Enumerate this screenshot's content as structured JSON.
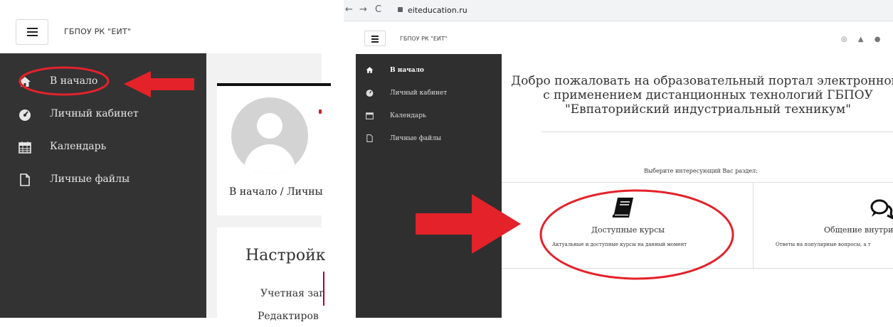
{
  "left_panel": {
    "brand": "ГБПОУ РК \"ЕИТ\"",
    "nav": [
      {
        "label": "В начало",
        "icon": "home-icon"
      },
      {
        "label": "Личный кабинет",
        "icon": "dashboard-icon"
      },
      {
        "label": "Календарь",
        "icon": "calendar-icon"
      },
      {
        "label": "Личные файлы",
        "icon": "file-icon"
      }
    ],
    "breadcrumb": "В начало  /  Личны",
    "settings_title": "Настройк",
    "account_label": "Учетная заг",
    "cut_text": "Редактиров"
  },
  "right_panel": {
    "url": "eiteducation.ru",
    "brand": "ГБПОУ РК \"ЕИТ\"",
    "header_icons": "◎ ▲ ●",
    "nav": [
      {
        "label": "В начало",
        "icon": "home-icon"
      },
      {
        "label": "Личный кабинет",
        "icon": "dashboard-icon"
      },
      {
        "label": "Календарь",
        "icon": "calendar-icon"
      },
      {
        "label": "Личные файлы",
        "icon": "file-icon"
      }
    ],
    "welcome": {
      "line1": "Добро пожаловать на образовательный портал электронного",
      "line2": "с применением дистанционных технологий ГБПОУ",
      "line3": "\"Евпаторийский индустриальный техникум\""
    },
    "choose_label": "Выберите интересующий Вас раздел:",
    "sections": [
      {
        "title": "Доступные курсы",
        "desc": "Актуальные и доступные курсы на данный момент",
        "icon": "book-icon"
      },
      {
        "title": "Общение внутри",
        "desc": "Ответы на популярные вопросы, а т",
        "icon": "chat-bubbles-icon"
      }
    ]
  },
  "annotation_color": "#e3222a"
}
